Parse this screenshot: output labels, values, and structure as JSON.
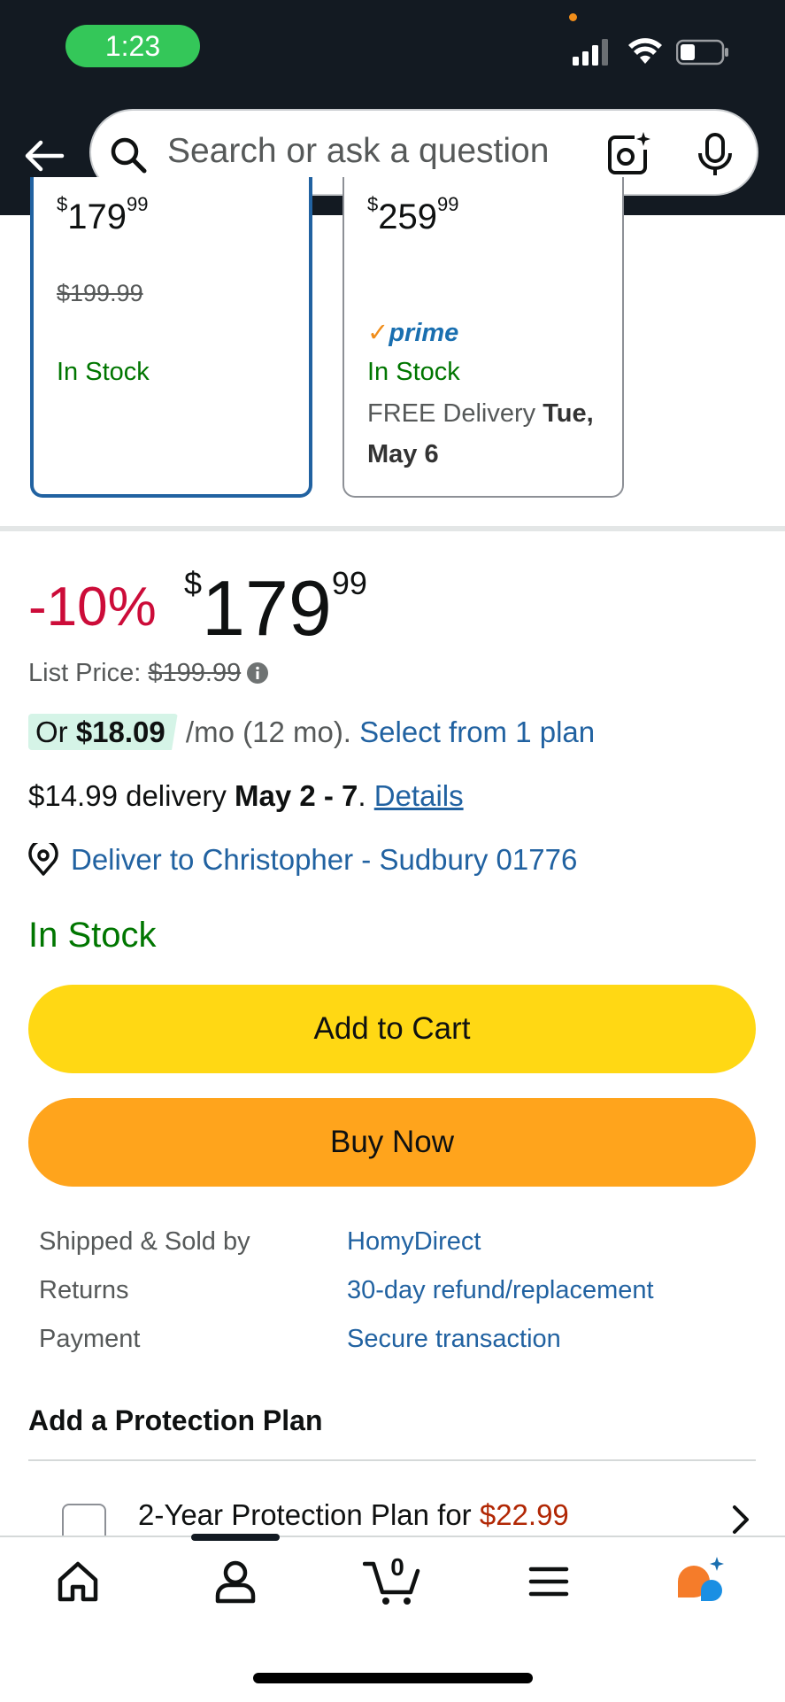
{
  "status_bar": {
    "time": "1:23",
    "icons": [
      "signal-icon",
      "wifi-icon",
      "battery-icon"
    ]
  },
  "header": {
    "search_placeholder": "Search or ask a question",
    "icons": [
      "back-arrow-icon",
      "search-icon",
      "camera-lens-icon",
      "microphone-icon"
    ]
  },
  "variants": [
    {
      "price_whole": "179",
      "price_cents": "99",
      "list_price": "$199.99",
      "stock": "In Stock",
      "selected": true
    },
    {
      "price_whole": "259",
      "price_cents": "99",
      "prime": "prime",
      "stock": "In Stock",
      "delivery_prefix": "FREE Delivery ",
      "delivery_date": "Tue, May 6",
      "selected": false
    }
  ],
  "buybox": {
    "discount": "-10%",
    "currency": "$",
    "price_whole": "179",
    "price_cents": "99",
    "list_price_label": "List Price: ",
    "list_price": "$199.99",
    "plan_or": "Or ",
    "plan_amount": "$18.09",
    "plan_term": " /mo (12 mo). ",
    "plan_link": "Select from 1 plan",
    "delivery_fee": "$14.99 delivery ",
    "delivery_dates": "May 2 - 7",
    "delivery_period": ". ",
    "details_link": "Details",
    "deliver_to": "Deliver to Christopher - Sudbury 01776",
    "stock": "In Stock",
    "add_to_cart": "Add to Cart",
    "buy_now": "Buy Now"
  },
  "seller_info": [
    {
      "label": "Shipped & Sold by",
      "value": "HomyDirect"
    },
    {
      "label": "Returns",
      "value": "30-day refund/replacement"
    },
    {
      "label": "Payment",
      "value": "Secure transaction"
    }
  ],
  "protection": {
    "title": "Add a Protection Plan",
    "item_text": "2-Year Protection Plan for ",
    "item_price": "$22.99"
  },
  "bottom_nav": {
    "cart_count": "0",
    "tabs": [
      "home-icon",
      "account-icon",
      "cart-icon",
      "menu-icon",
      "rufus-icon"
    ]
  },
  "colors": {
    "header": "#131a22",
    "add_to_cart": "#ffd814",
    "buy_now": "#ffa41c",
    "link": "#2162a1",
    "in_stock": "#007600",
    "discount": "#cc0c39",
    "selected_border": "#2162a1"
  }
}
